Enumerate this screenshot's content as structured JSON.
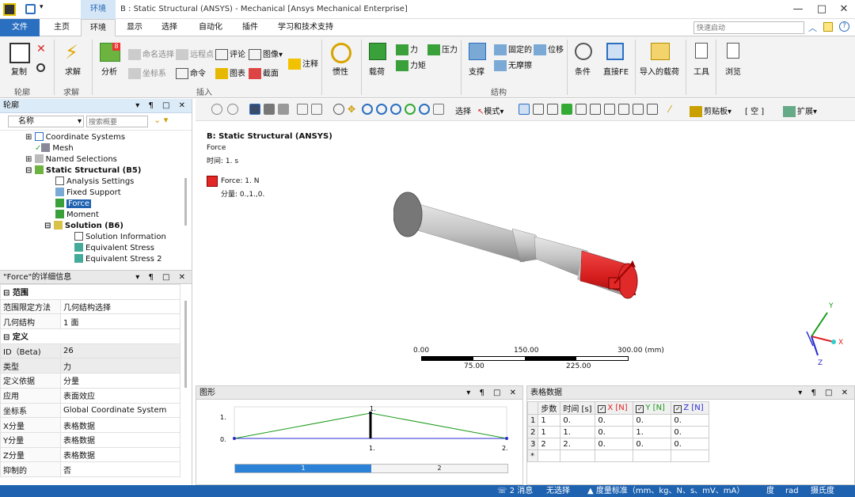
{
  "titlebar": {
    "context_tab": "环境",
    "title": "B : Static Structural (ANSYS) - Mechanical [Ansys Mechanical Enterprise]",
    "minimize": "—",
    "maximize": "□",
    "close": "✕"
  },
  "tabs": {
    "file": "文件",
    "items": [
      "主页",
      "环境",
      "显示",
      "选择",
      "自动化",
      "插件",
      "学习和技术支持"
    ],
    "quick_launch_placeholder": "快速启动"
  },
  "ribbon": {
    "copy": "复制",
    "outline_group": "轮廓",
    "solve": "求解",
    "solve_group": "求解",
    "analysis": "分析",
    "named_select": "命名选择",
    "remote_point": "远程点",
    "comment": "评论",
    "image": "图像",
    "annotation": "注释",
    "coord_sys": "坐标系",
    "command": "命令",
    "chart": "图表",
    "section": "截面",
    "insert_group": "插入",
    "inertia": "惯性",
    "load": "载荷",
    "force": "力",
    "pressure": "压力",
    "moment": "力矩",
    "support": "支撑",
    "fixed": "固定的",
    "displacement": "位移",
    "frictionless": "无摩擦",
    "structure_group": "结构",
    "conditions": "条件",
    "direct_fe": "直接FE",
    "import_load": "导入的载荷",
    "tools": "工具",
    "browse": "浏览"
  },
  "outline": {
    "title": "轮廓",
    "name_label": "名称",
    "search_placeholder": "搜索概要",
    "items": [
      "Coordinate Systems",
      "Mesh",
      "Named Selections",
      "Static Structural (B5)",
      "Analysis Settings",
      "Fixed Support",
      "Force",
      "Moment",
      "Solution (B6)",
      "Solution Information",
      "Equivalent Stress",
      "Equivalent Stress 2"
    ]
  },
  "details": {
    "title": "\"Force\"的详细信息",
    "groups": {
      "scope": "范围",
      "definition": "定义"
    },
    "rows": [
      {
        "k": "范围限定方法",
        "v": "几何结构选择"
      },
      {
        "k": "几何结构",
        "v": "1 面"
      },
      {
        "k": "ID（Beta)",
        "v": "26"
      },
      {
        "k": "类型",
        "v": "力"
      },
      {
        "k": "定义依据",
        "v": "分量"
      },
      {
        "k": "应用",
        "v": "表面效应"
      },
      {
        "k": "坐标系",
        "v": "Global Coordinate System"
      },
      {
        "k": "X分量",
        "v": "表格数据"
      },
      {
        "k": "Y分量",
        "v": "表格数据"
      },
      {
        "k": "Z分量",
        "v": "表格数据"
      },
      {
        "k": "抑制的",
        "v": "否"
      }
    ]
  },
  "viewport": {
    "toolbar": {
      "select": "选择",
      "mode": "模式",
      "clipboard": "剪贴板",
      "empty": "[ 空 ]",
      "expand": "扩展"
    },
    "header_title": "B: Static Structural (ANSYS)",
    "header_sub": "Force",
    "header_time": "时间: 1. s",
    "legend_label": "Force: 1. N",
    "legend_comp": "分量: 0.,1.,0.",
    "scale": {
      "top": [
        "0.00",
        "150.00",
        "300.00 (mm)"
      ],
      "bottom": [
        "75.00",
        "225.00"
      ]
    },
    "axes": {
      "x": "X",
      "y": "Y",
      "z": "Z"
    },
    "colors": {
      "force": "#e32727",
      "shaft": "#c4c4c4"
    }
  },
  "graph": {
    "title": "图形",
    "y_ticks": [
      "1.",
      "0."
    ],
    "x_ticks": [
      "1.",
      "2."
    ],
    "peak_label": "1.",
    "steps": [
      "1",
      "2"
    ],
    "chart_data": {
      "type": "line",
      "x": [
        0,
        1,
        2
      ],
      "series": [
        {
          "values": [
            0,
            1,
            0
          ]
        }
      ],
      "xlim": [
        0,
        2
      ],
      "ylim": [
        0,
        1
      ]
    }
  },
  "tabular": {
    "title": "表格数据",
    "headers": [
      "步数",
      "时间 [s]",
      "X [N]",
      "Y [N]",
      "Z [N]"
    ],
    "rows": [
      [
        "1",
        "1",
        "0.",
        "0.",
        "0.",
        "0."
      ],
      [
        "2",
        "1",
        "1.",
        "0.",
        "1.",
        "0."
      ],
      [
        "3",
        "2",
        "2.",
        "0.",
        "0.",
        "0."
      ]
    ],
    "new_row": "*"
  },
  "status": {
    "messages": "2 消息",
    "selection": "无选择",
    "units": "度量标准（mm、kg、N、s、mV、mA）",
    "deg": "度",
    "rad": "rad",
    "celsius": "摄氏度"
  }
}
